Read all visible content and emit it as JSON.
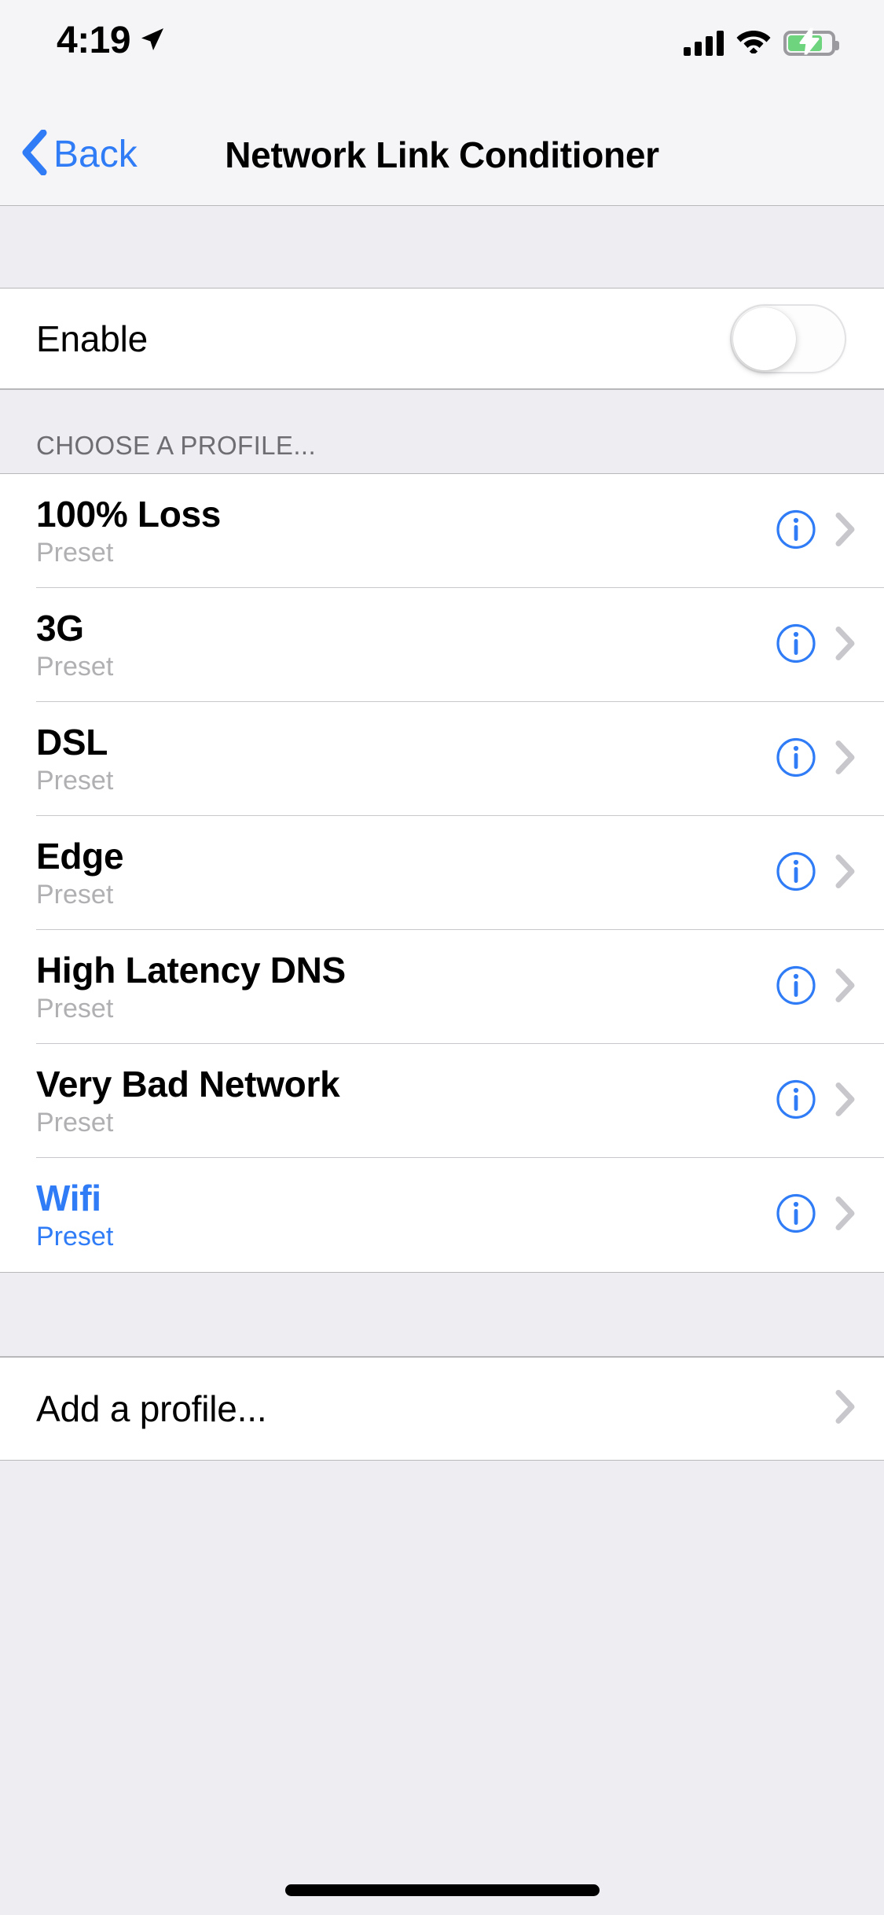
{
  "status_bar": {
    "time": "4:19",
    "location_icon": "location-arrow-icon",
    "cellular_icon": "cellular-signal-icon",
    "cellular_bars": 4,
    "wifi_icon": "wifi-icon",
    "battery_icon": "battery-charging-icon",
    "battery_level_percent": 74,
    "battery_charging": true,
    "battery_fill_color": "#6fd47e"
  },
  "nav_bar": {
    "back_label": "Back",
    "back_icon": "chevron-left-icon",
    "title": "Network Link Conditioner",
    "accent_color": "#2f7cf6"
  },
  "enable_section": {
    "label": "Enable",
    "toggle_state": "off"
  },
  "profiles_section": {
    "header": "CHOOSE A PROFILE...",
    "items": [
      {
        "title": "100% Loss",
        "subtitle": "Preset",
        "selected": false
      },
      {
        "title": "3G",
        "subtitle": "Preset",
        "selected": false
      },
      {
        "title": "DSL",
        "subtitle": "Preset",
        "selected": false
      },
      {
        "title": "Edge",
        "subtitle": "Preset",
        "selected": false
      },
      {
        "title": "High Latency DNS",
        "subtitle": "Preset",
        "selected": false
      },
      {
        "title": "Very Bad Network",
        "subtitle": "Preset",
        "selected": false
      },
      {
        "title": "Wifi",
        "subtitle": "Preset",
        "selected": true
      }
    ],
    "info_icon": "info-circle-icon",
    "disclosure_icon": "chevron-right-icon"
  },
  "add_section": {
    "label": "Add a profile...",
    "disclosure_icon": "chevron-right-icon"
  },
  "home_indicator": "home-indicator"
}
